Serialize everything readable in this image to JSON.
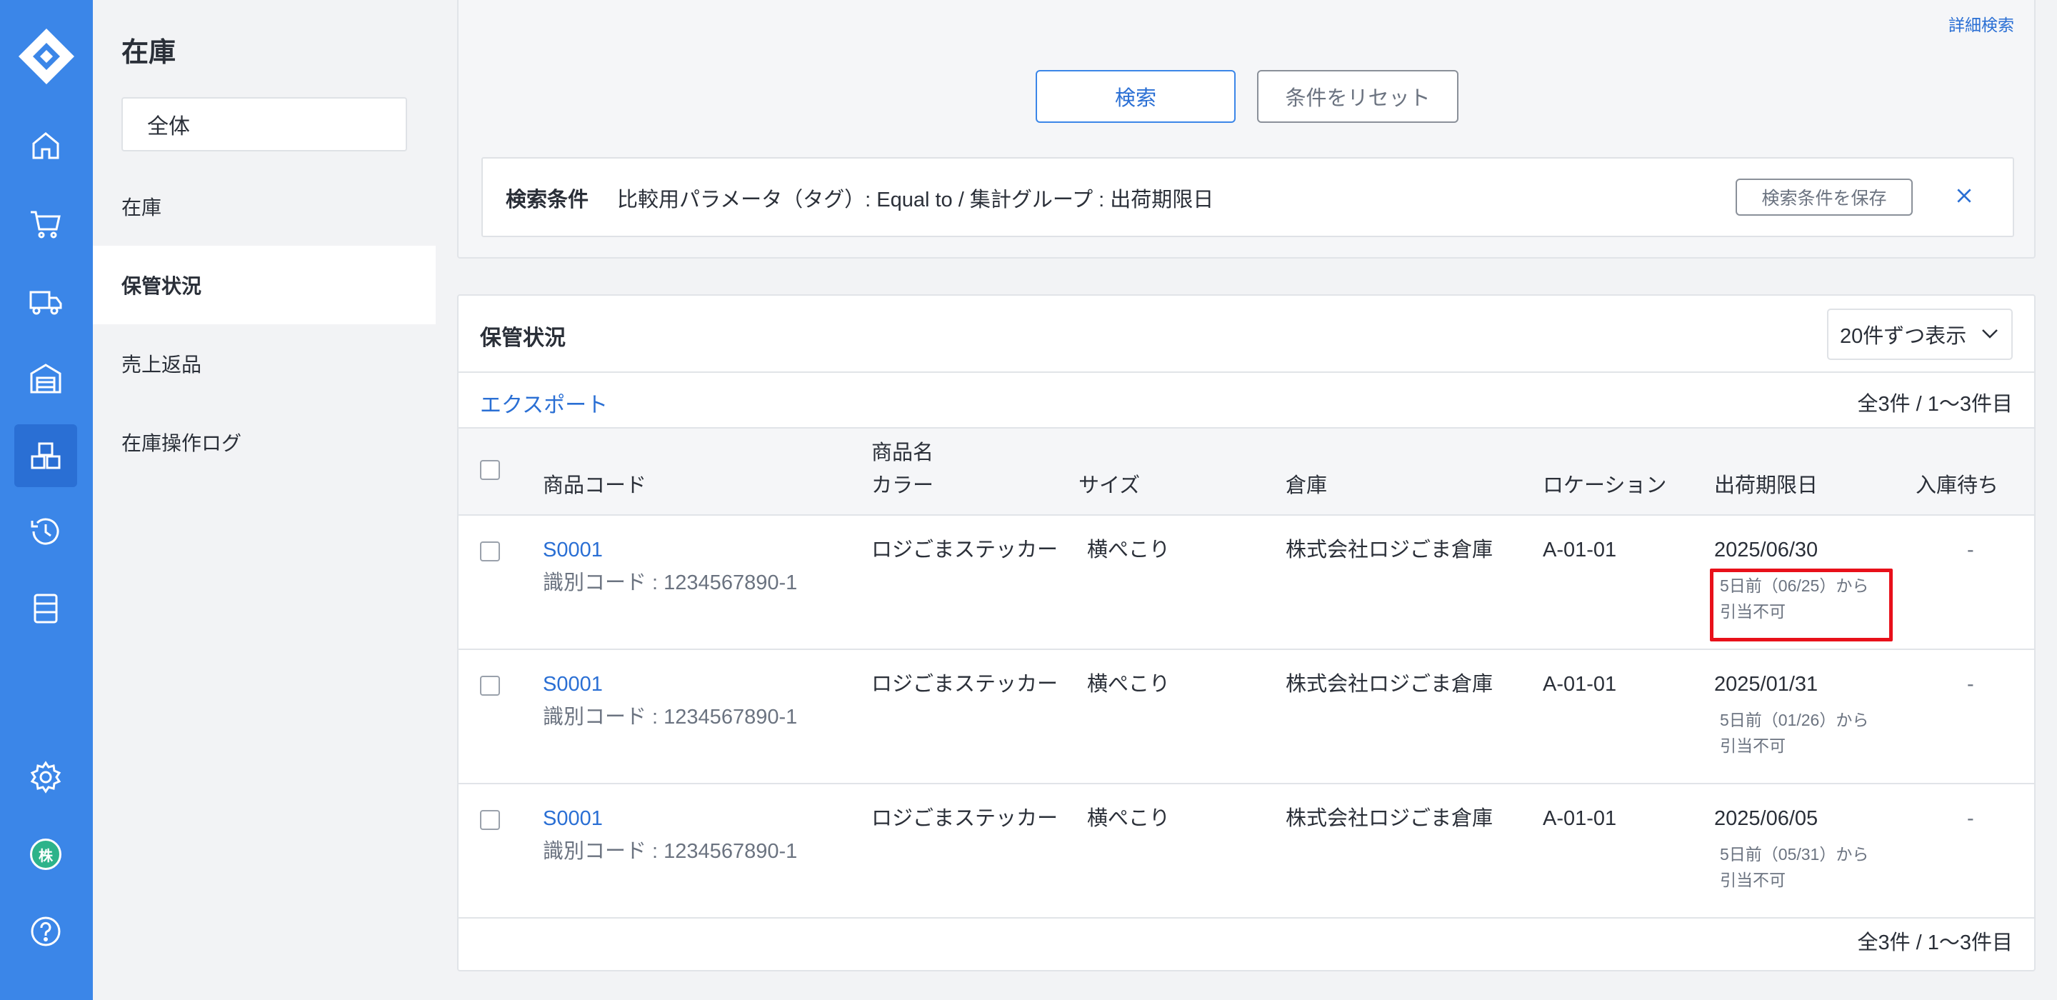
{
  "rail": {
    "items": [
      "home-icon",
      "cart-icon",
      "truck-icon",
      "warehouse-icon",
      "inventory-icon",
      "history-icon",
      "list-icon"
    ],
    "active": "inventory-icon",
    "bottom": [
      "gear-icon",
      "avatar",
      "help-icon"
    ],
    "avatar_text": "株",
    "accent": "#3b86e8"
  },
  "sidebar": {
    "title": "在庫",
    "scope": "全体",
    "items": [
      {
        "label": "在庫"
      },
      {
        "label": "保管状況"
      },
      {
        "label": "売上返品"
      },
      {
        "label": "在庫操作ログ"
      }
    ],
    "active": "保管状況"
  },
  "search": {
    "advanced_link": "詳細検索",
    "search_button": "検索",
    "reset_button": "条件をリセット",
    "condition_label": "検索条件",
    "condition_text": "比較用パラメータ（タグ）: Equal to / 集計グループ : 出荷期限日",
    "save_button": "検索条件を保存"
  },
  "results": {
    "title": "保管状況",
    "per_page": "20件ずつ表示",
    "export": "エクスポート",
    "count": "全3件 / 1〜3件目",
    "footer_count": "全3件 / 1〜3件目",
    "columns": {
      "code": "商品コード",
      "name": "商品名",
      "color": "カラー",
      "size": "サイズ",
      "warehouse": "倉庫",
      "location": "ロケーション",
      "deadline": "出荷期限日",
      "pending": "入庫待ち"
    },
    "rows": [
      {
        "code": "S0001",
        "id_code": "識別コード : 1234567890-1",
        "name": "ロジごまステッカー",
        "size": "横ぺこり",
        "warehouse": "株式会社ロジごま倉庫",
        "location": "A-01-01",
        "deadline": "2025/06/30",
        "note1": "5日前（06/25）から",
        "note2": "引当不可",
        "pending": "-"
      },
      {
        "code": "S0001",
        "id_code": "識別コード : 1234567890-1",
        "name": "ロジごまステッカー",
        "size": "横ぺこり",
        "warehouse": "株式会社ロジごま倉庫",
        "location": "A-01-01",
        "deadline": "2025/01/31",
        "note1": "5日前（01/26）から",
        "note2": "引当不可",
        "pending": "-"
      },
      {
        "code": "S0001",
        "id_code": "識別コード : 1234567890-1",
        "name": "ロジごまステッカー",
        "size": "横ぺこり",
        "warehouse": "株式会社ロジごま倉庫",
        "location": "A-01-01",
        "deadline": "2025/06/05",
        "note1": "5日前（05/31）から",
        "note2": "引当不可",
        "pending": "-"
      }
    ],
    "highlight_color": "#e8101a"
  }
}
